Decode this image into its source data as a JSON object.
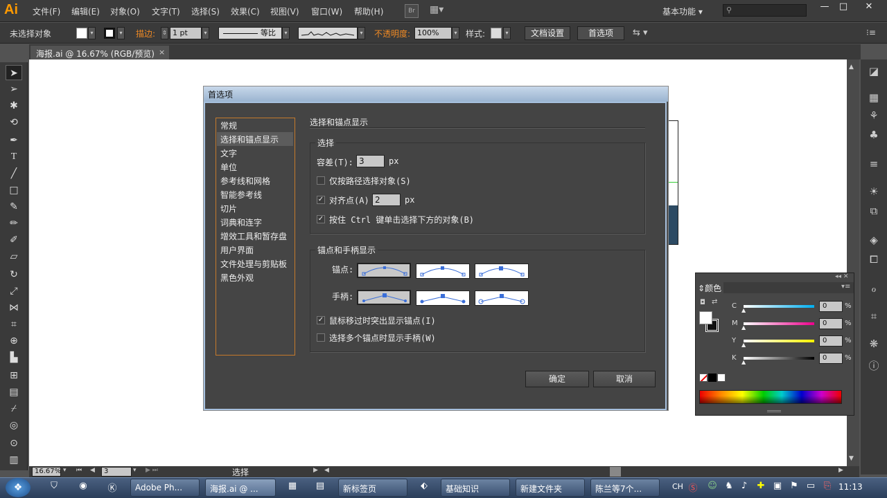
{
  "app": {
    "logo": "Ai",
    "document_tab": "海报.ai @ 16.67% (RGB/预览)",
    "tab_close": "×"
  },
  "menu": [
    "文件(F)",
    "编辑(E)",
    "对象(O)",
    "文字(T)",
    "选择(S)",
    "效果(C)",
    "视图(V)",
    "窗口(W)",
    "帮助(H)"
  ],
  "menubar": {
    "br": "Br",
    "workspace": "基本功能",
    "window_buttons": [
      "—",
      "□",
      "✕"
    ]
  },
  "control_bar": {
    "selection": "未选择对象",
    "stroke_label": "描边:",
    "stroke_value": "1 pt",
    "profile": "等比",
    "opacity_label": "不透明度:",
    "opacity_value": "100%",
    "style_label": "样式:",
    "doc_setup": "文档设置",
    "prefs": "首选项"
  },
  "dialog": {
    "title": "首选项",
    "nav": [
      "常规",
      "选择和锚点显示",
      "文字",
      "单位",
      "参考线和网格",
      "智能参考线",
      "切片",
      "词典和连字",
      "增效工具和暂存盘",
      "用户界面",
      "文件处理与剪贴板",
      "黑色外观"
    ],
    "selected_nav": "选择和锚点显示",
    "section_title": "选择和锚点显示",
    "selection_group": {
      "title": "选择",
      "tolerance_label": "容差(T):",
      "tolerance_value": "3",
      "tolerance_unit": "px",
      "path_only": {
        "label": "仅按路径选择对象(S)",
        "checked": false
      },
      "snap": {
        "label": "对齐点(A)",
        "checked": true,
        "value": "2",
        "unit": "px"
      },
      "ctrl_click": {
        "label": "按住 Ctrl 键单击选择下方的对象(B)",
        "checked": true
      }
    },
    "anchor_group": {
      "title": "锚点和手柄显示",
      "anchor_label": "锚点:",
      "handle_label": "手柄:",
      "highlight": {
        "label": "鼠标移过时突出显示锚点(I)",
        "checked": true
      },
      "multi_handles": {
        "label": "选择多个锚点时显示手柄(W)",
        "checked": false
      }
    },
    "ok": "确定",
    "cancel": "取消",
    "check_mark": "✓"
  },
  "color_panel": {
    "title": "颜色",
    "channels": [
      {
        "label": "C",
        "value": "0",
        "color": "#00aeef"
      },
      {
        "label": "M",
        "value": "0",
        "color": "#ec008c"
      },
      {
        "label": "Y",
        "value": "0",
        "color": "#fff200"
      },
      {
        "label": "K",
        "value": "0",
        "color": "#000000"
      }
    ],
    "pct": "%"
  },
  "status": {
    "zoom": "16.67%",
    "page": "3",
    "mode": "选择"
  },
  "taskbar": {
    "apps": [
      "Adobe Ph...",
      "海报.ai @ ...",
      "新标签页",
      "基础知识",
      "新建文件夹",
      "陈兰等7个..."
    ],
    "lang": "CH",
    "time": "11:13"
  }
}
